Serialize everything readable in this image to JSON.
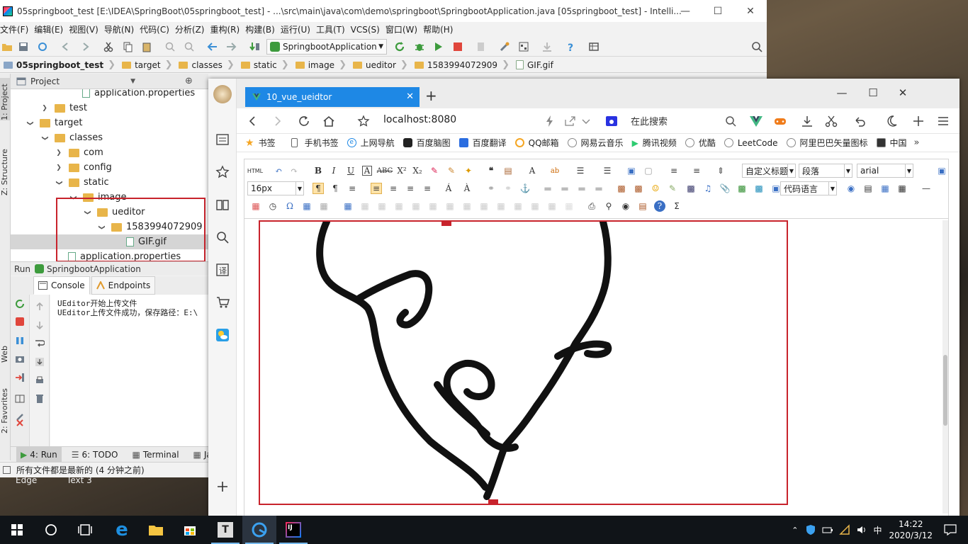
{
  "intellij": {
    "title": "05springboot_test [E:\\IDEA\\SpringBoot\\05springboot_test] - ...\\src\\main\\java\\com\\demo\\springboot\\SpringbootApplication.java [05springboot_test] - Intelli...",
    "menu": [
      "文件(F)",
      "编辑(E)",
      "视图(V)",
      "导航(N)",
      "代码(C)",
      "分析(Z)",
      "重构(R)",
      "构建(B)",
      "运行(U)",
      "工具(T)",
      "VCS(S)",
      "窗口(W)",
      "帮助(H)"
    ],
    "run_config": "SpringbootApplication",
    "breadcrumb": [
      "05springboot_test",
      "target",
      "classes",
      "static",
      "image",
      "ueditor",
      "1583994072909",
      "GIF.gif"
    ],
    "left_strip": [
      "1: Project",
      "Z: Structure",
      "Web",
      "2: Favorites"
    ],
    "project_panel_title": "Project",
    "tree": [
      {
        "label": "application.properties",
        "type": "file"
      },
      {
        "label": "test",
        "type": "folder",
        "expanded": false
      },
      {
        "label": "target",
        "type": "folder",
        "expanded": true
      },
      {
        "label": "classes",
        "type": "folder",
        "expanded": true
      },
      {
        "label": "com",
        "type": "folder",
        "expanded": false
      },
      {
        "label": "config",
        "type": "folder",
        "expanded": false
      },
      {
        "label": "static",
        "type": "folder",
        "expanded": true
      },
      {
        "label": "image",
        "type": "folder",
        "expanded": true
      },
      {
        "label": "ueditor",
        "type": "folder",
        "expanded": true
      },
      {
        "label": "1583994072909",
        "type": "folder",
        "expanded": true
      },
      {
        "label": "GIF.gif",
        "type": "file",
        "selected": true
      },
      {
        "label": "application.properties",
        "type": "file"
      }
    ],
    "run_panel": {
      "label": "Run",
      "config": "SpringbootApplication",
      "tabs": [
        "Console",
        "Endpoints"
      ]
    },
    "console_lines": [
      "UEditor开始上传文件",
      "UEditor上传文件成功，保存路径：E:\\"
    ],
    "bottom_tabs": [
      "4: Run",
      "6: TODO",
      "Terminal",
      "Java"
    ],
    "status": "所有文件都是最新的 (4 分钟之前)"
  },
  "desktop_labels": [
    "Edge",
    "Text 3"
  ],
  "browser": {
    "tab_title": "10_vue_ueidtor",
    "address": "localhost:8080",
    "search_placeholder": "在此搜索",
    "bookmarks": [
      "书签",
      "手机书签",
      "上网导航",
      "百度脑图",
      "百度翻译",
      "QQ邮箱",
      "网易云音乐",
      "腾讯视频",
      "优酷",
      "LeetCode",
      "阿里巴巴矢量图标",
      "中国"
    ]
  },
  "ueditor": {
    "font_size": "16px",
    "custom_title": "自定义标题",
    "paragraph": "段落",
    "font_family": "arial",
    "code_language": "代码语言"
  },
  "taskbar": {
    "time": "14:22",
    "date": "2020/3/12",
    "ime": "中"
  },
  "colors": {
    "tab_blue": "#1e88e5",
    "highlight_red": "#c8232c",
    "folder_yellow": "#e8b54a"
  }
}
